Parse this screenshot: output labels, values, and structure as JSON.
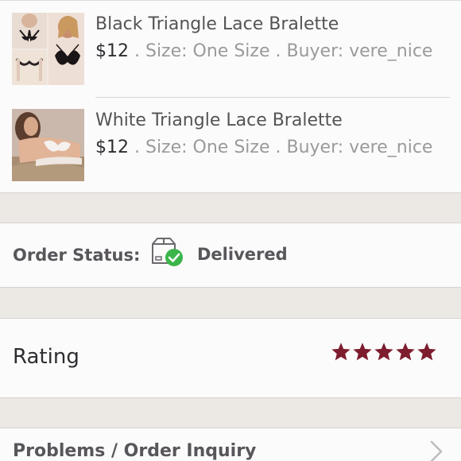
{
  "items": [
    {
      "title": "Black Triangle Lace Bralette",
      "price": "$12",
      "details": " . Size: One Size . Buyer: vere_nice"
    },
    {
      "title": "White Triangle Lace Bralette",
      "price": "$12",
      "details": " . Size: One Size . Buyer: vere_nice"
    }
  ],
  "order_status": {
    "label": "Order Status:",
    "value": "Delivered",
    "icon": "box-delivered-icon",
    "check_color": "#3bb54a"
  },
  "rating": {
    "label": "Rating",
    "stars": 5,
    "max_stars": 5,
    "star_color": "#7d1d2e"
  },
  "inquiry": {
    "label": "Problems / Order Inquiry",
    "icon": "chevron-right-icon"
  }
}
